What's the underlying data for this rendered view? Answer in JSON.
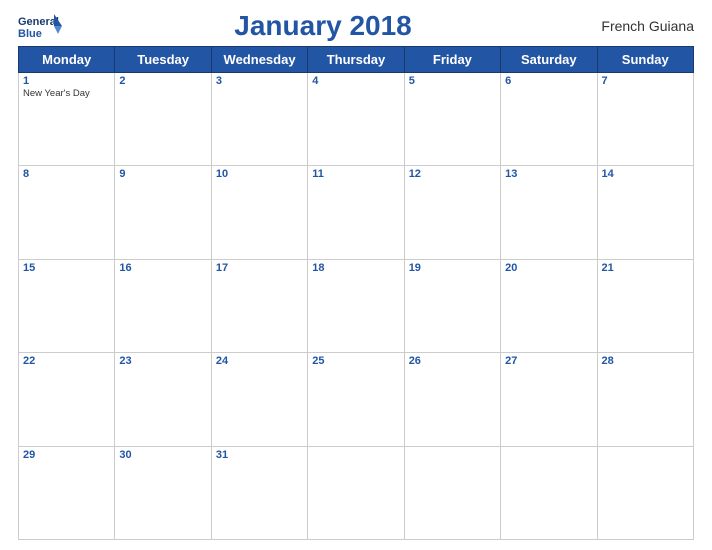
{
  "header": {
    "logo_general": "General",
    "logo_blue": "Blue",
    "title": "January 2018",
    "region": "French Guiana"
  },
  "weekdays": [
    "Monday",
    "Tuesday",
    "Wednesday",
    "Thursday",
    "Friday",
    "Saturday",
    "Sunday"
  ],
  "weeks": [
    [
      {
        "day": "1",
        "event": "New Year's Day"
      },
      {
        "day": "2",
        "event": ""
      },
      {
        "day": "3",
        "event": ""
      },
      {
        "day": "4",
        "event": ""
      },
      {
        "day": "5",
        "event": ""
      },
      {
        "day": "6",
        "event": ""
      },
      {
        "day": "7",
        "event": ""
      }
    ],
    [
      {
        "day": "8",
        "event": ""
      },
      {
        "day": "9",
        "event": ""
      },
      {
        "day": "10",
        "event": ""
      },
      {
        "day": "11",
        "event": ""
      },
      {
        "day": "12",
        "event": ""
      },
      {
        "day": "13",
        "event": ""
      },
      {
        "day": "14",
        "event": ""
      }
    ],
    [
      {
        "day": "15",
        "event": ""
      },
      {
        "day": "16",
        "event": ""
      },
      {
        "day": "17",
        "event": ""
      },
      {
        "day": "18",
        "event": ""
      },
      {
        "day": "19",
        "event": ""
      },
      {
        "day": "20",
        "event": ""
      },
      {
        "day": "21",
        "event": ""
      }
    ],
    [
      {
        "day": "22",
        "event": ""
      },
      {
        "day": "23",
        "event": ""
      },
      {
        "day": "24",
        "event": ""
      },
      {
        "day": "25",
        "event": ""
      },
      {
        "day": "26",
        "event": ""
      },
      {
        "day": "27",
        "event": ""
      },
      {
        "day": "28",
        "event": ""
      }
    ],
    [
      {
        "day": "29",
        "event": ""
      },
      {
        "day": "30",
        "event": ""
      },
      {
        "day": "31",
        "event": ""
      },
      {
        "day": "",
        "event": ""
      },
      {
        "day": "",
        "event": ""
      },
      {
        "day": "",
        "event": ""
      },
      {
        "day": "",
        "event": ""
      }
    ]
  ]
}
